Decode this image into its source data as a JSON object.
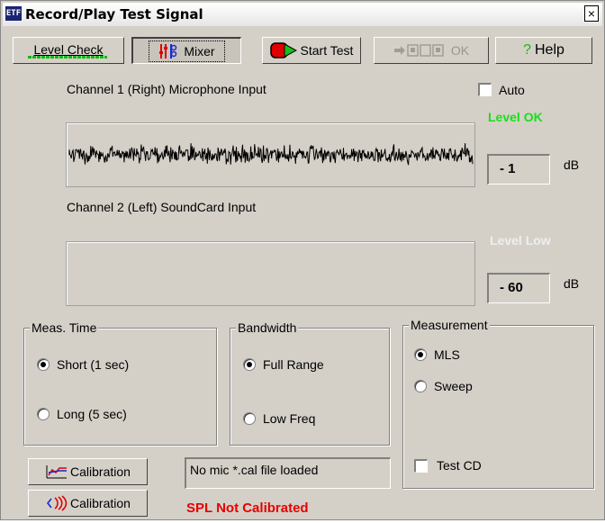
{
  "window": {
    "title": "Record/Play Test Signal",
    "icon_text": "ETF",
    "close_label": "×"
  },
  "toolbar": {
    "level_check_label": "Level Check",
    "mixer_label": "Mixer",
    "start_test_label": "Start Test",
    "ok_label": "OK",
    "help_label": "Help",
    "help_glyph": "?"
  },
  "channel1": {
    "label": "Channel 1 (Right) Microphone Input",
    "level_status": "Level OK",
    "level_value": "- 1",
    "unit": "dB",
    "status_color": "#18e018"
  },
  "channel2": {
    "label": "Channel 2 (Left) SoundCard Input",
    "level_status": "Level Low",
    "level_value": "- 60",
    "unit": "dB",
    "status_color": "#eeeeee"
  },
  "auto": {
    "label": "Auto",
    "checked": false
  },
  "meas_time": {
    "title": "Meas. Time",
    "options": [
      {
        "label": "Short (1 sec)",
        "selected": true
      },
      {
        "label": "Long (5 sec)",
        "selected": false
      }
    ]
  },
  "bandwidth": {
    "title": "Bandwidth",
    "options": [
      {
        "label": "Full Range",
        "selected": true
      },
      {
        "label": "Low Freq",
        "selected": false
      }
    ]
  },
  "measurement": {
    "title": "Measurement",
    "options": [
      {
        "label": "MLS",
        "selected": true
      },
      {
        "label": "Sweep",
        "selected": false
      }
    ],
    "test_cd_label": "Test CD",
    "test_cd_checked": false
  },
  "calibration": {
    "mic_button_label": "Calibration",
    "soundcard_button_label": "Calibration",
    "file_status": "No mic *.cal file loaded",
    "spl_status": "SPL Not Calibrated"
  }
}
